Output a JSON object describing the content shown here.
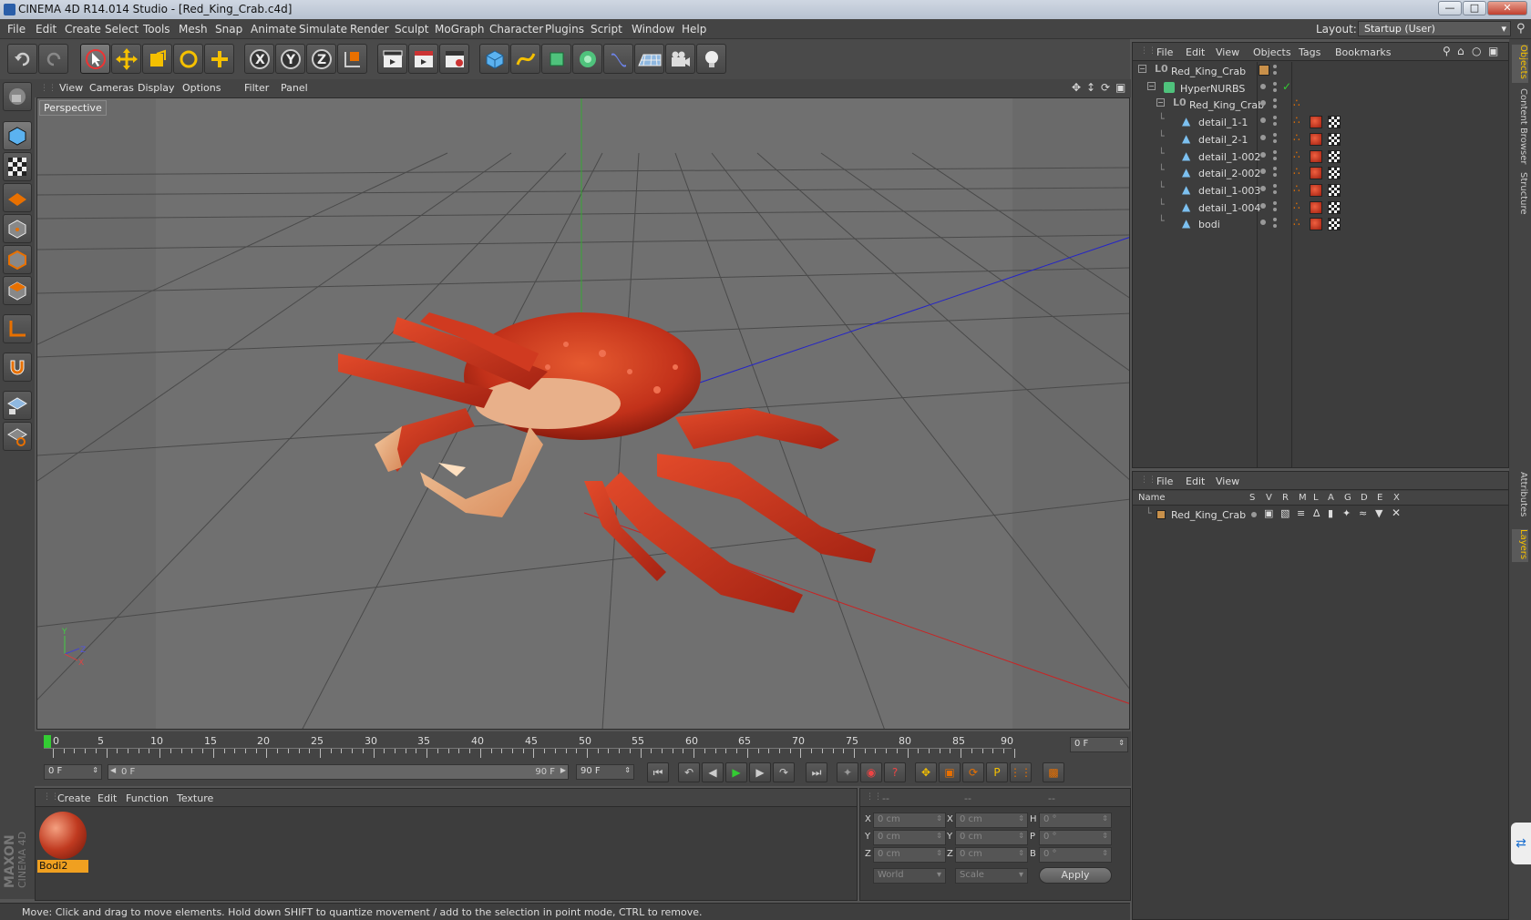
{
  "window": {
    "title": "CINEMA 4D R14.014 Studio - [Red_King_Crab.c4d]"
  },
  "menu": [
    "File",
    "Edit",
    "Create",
    "Select",
    "Tools",
    "Mesh",
    "Snap",
    "Animate",
    "Simulate",
    "Render",
    "Sculpt",
    "MoGraph",
    "Character",
    "Plugins",
    "Script",
    "Window",
    "Help"
  ],
  "layout": {
    "label": "Layout:",
    "value": "Startup (User)"
  },
  "viewport": {
    "menu": [
      "View",
      "Cameras",
      "Display",
      "Options",
      "Filter",
      "Panel"
    ],
    "label": "Perspective",
    "axes": {
      "x": "X",
      "y": "Y",
      "z": "Z"
    }
  },
  "timeline": {
    "ticks": [
      "0",
      "5",
      "10",
      "15",
      "20",
      "25",
      "30",
      "35",
      "40",
      "45",
      "50",
      "55",
      "60",
      "65",
      "70",
      "75",
      "80",
      "85",
      "90"
    ],
    "current_frame": "0 F",
    "start_field": "0 F",
    "range_start": "0 F",
    "range_end": "90 F",
    "end_field": "90 F"
  },
  "materials": {
    "menu": [
      "Create",
      "Edit",
      "Function",
      "Texture"
    ],
    "items": [
      {
        "name": "Bodi2"
      }
    ]
  },
  "coords": {
    "headers": [
      "--",
      "--",
      "--"
    ],
    "rows": [
      {
        "a": "X",
        "av": "0 cm",
        "b": "X",
        "bv": "0 cm",
        "c": "H",
        "cv": "0 °"
      },
      {
        "a": "Y",
        "av": "0 cm",
        "b": "Y",
        "bv": "0 cm",
        "c": "P",
        "cv": "0 °"
      },
      {
        "a": "Z",
        "av": "0 cm",
        "b": "Z",
        "bv": "0 cm",
        "c": "B",
        "cv": "0 °"
      }
    ],
    "world": "World",
    "scale": "Scale",
    "apply": "Apply"
  },
  "status": "Move: Click and drag to move elements. Hold down SHIFT to quantize movement / add to the selection in point mode, CTRL to remove.",
  "objects": {
    "menu": [
      "File",
      "Edit",
      "View",
      "Objects",
      "Tags",
      "Bookmarks"
    ],
    "tree": [
      {
        "name": "Red_King_Crab",
        "depth": 0
      },
      {
        "name": "HyperNURBS",
        "depth": 1
      },
      {
        "name": "Red_King_Crab",
        "depth": 2
      },
      {
        "name": "detail_1-1",
        "depth": 3
      },
      {
        "name": "detail_2-1",
        "depth": 3
      },
      {
        "name": "detail_1-002",
        "depth": 3
      },
      {
        "name": "detail_2-002",
        "depth": 3
      },
      {
        "name": "detail_1-003",
        "depth": 3
      },
      {
        "name": "detail_1-004",
        "depth": 3
      },
      {
        "name": "bodi",
        "depth": 3
      }
    ]
  },
  "layers": {
    "menu": [
      "File",
      "Edit",
      "View"
    ],
    "columns": [
      "Name",
      "S",
      "V",
      "R",
      "M",
      "L",
      "A",
      "G",
      "D",
      "E",
      "X"
    ],
    "rows": [
      {
        "name": "Red_King_Crab"
      }
    ]
  },
  "right_tabs": [
    "Objects",
    "Content Browser",
    "Structure",
    "Attributes",
    "Layers"
  ],
  "brand": {
    "line1": "MAXON",
    "line2": "CINEMA 4D"
  }
}
